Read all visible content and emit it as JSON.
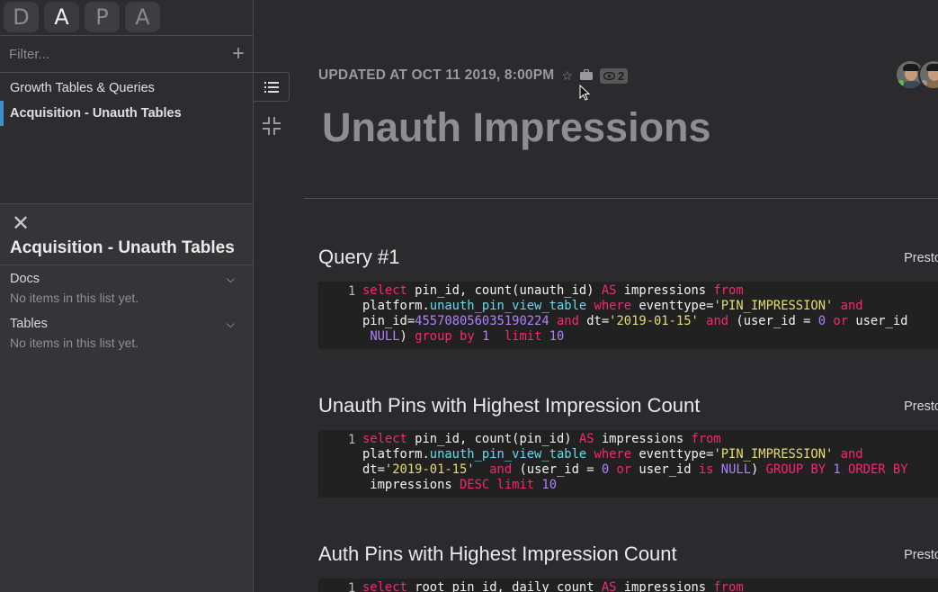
{
  "sidebar": {
    "tabs": [
      "D",
      "A",
      "P",
      "A"
    ],
    "filter_placeholder": "Filter...",
    "nav_items": [
      "Growth Tables & Queries",
      "Acquisition - Unauth Tables"
    ],
    "detail": {
      "title": "Acquisition - Unauth Tables",
      "sections": [
        {
          "label": "Docs",
          "empty_text": "No items in this list yet."
        },
        {
          "label": "Tables",
          "empty_text": "No items in this list yet."
        }
      ]
    }
  },
  "header": {
    "updated": "UPDATED AT OCT 11 2019, 8:00PM",
    "view_count": "2",
    "title": "Unauth Impressions"
  },
  "queries": [
    {
      "title": "Query #1",
      "engine": "Presto",
      "line_number": "1"
    },
    {
      "title": "Unauth Pins with Highest Impression Count",
      "engine": "Presto",
      "line_number": "1"
    },
    {
      "title": "Auth Pins with Highest Impression Count",
      "engine": "Presto",
      "line_number": "1"
    }
  ],
  "colors": {
    "keyword": "#f92672",
    "table": "#66d9ef",
    "string": "#e6db74",
    "number": "#ae81ff",
    "active_nav": "#3f8fc9"
  }
}
